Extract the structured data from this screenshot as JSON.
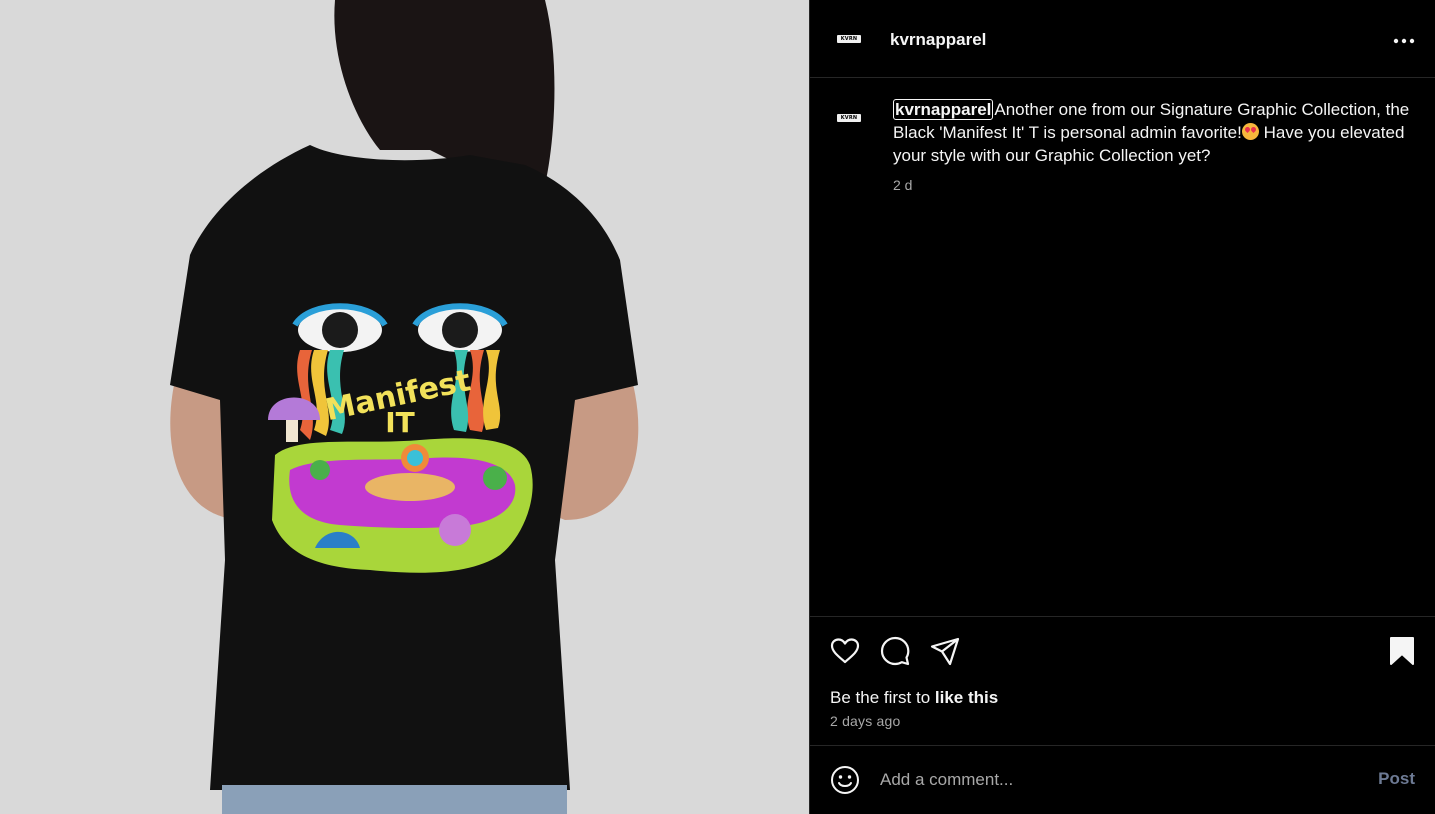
{
  "post": {
    "username": "kvrnapparel",
    "avatar_text": "KVRN",
    "caption_text": "Another one from our Signature Graphic Collection, the Black 'Manifest It' T is personal admin favorite!",
    "caption_text_2": " Have you elevated your style with our Graphic Collection yet?",
    "emoji": "star-struck",
    "timestamp": "2 d",
    "likes_prefix": "Be the first to ",
    "likes_action": "like this",
    "date": "2 days ago",
    "artwork_text": "Manifest IT"
  },
  "comment": {
    "placeholder": "Add a comment...",
    "post_label": "Post"
  },
  "icons": {
    "more": "more-horizontal-icon",
    "like": "heart-icon",
    "comment": "comment-bubble-icon",
    "share": "paper-plane-icon",
    "save": "bookmark-icon",
    "emoji": "smiley-icon"
  },
  "colors": {
    "background": "#000000",
    "text": "#f5f5f5",
    "secondary_text": "#a8a8a8",
    "divider": "#262626",
    "post_button_disabled": "#6d7a94",
    "photo_background": "#d9d9d9"
  }
}
